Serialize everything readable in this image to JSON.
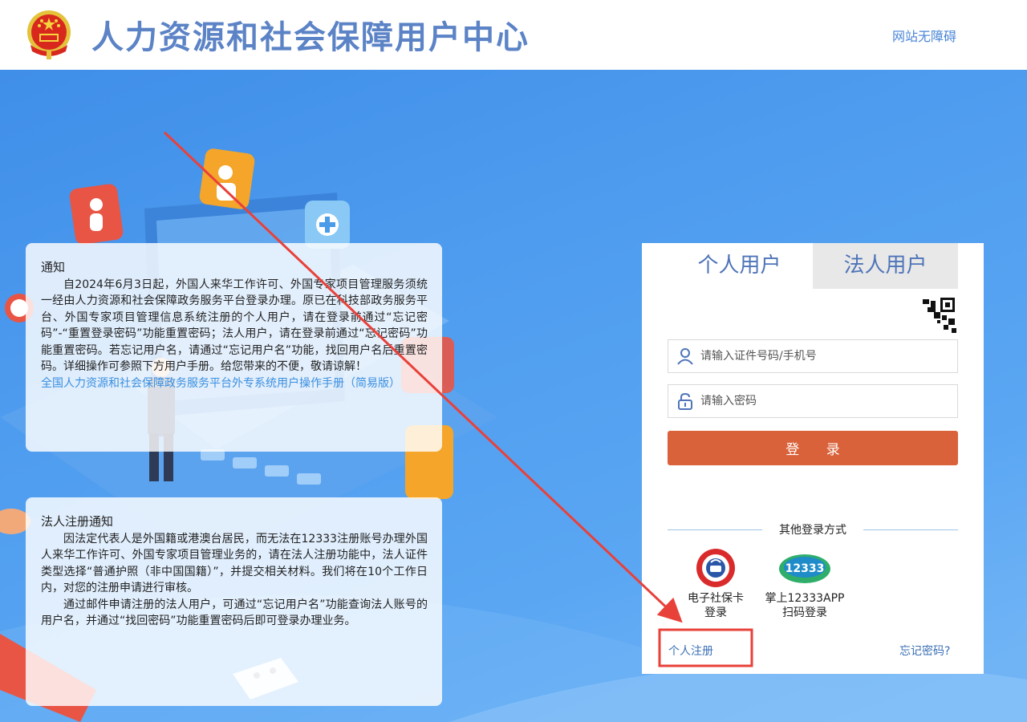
{
  "header": {
    "title": "人力资源和社会保障用户中心",
    "accessibility": "网站无障碍"
  },
  "notice_1": {
    "title": "通知",
    "body": "自2024年6月3日起，外国人来华工作许可、外国专家项目管理服务须统一经由人力资源和社会保障政务服务平台登录办理。原已在科技部政务服务平台、外国专家项目管理信息系统注册的个人用户，请在登录前通过“忘记密码”-“重置登录密码”功能重置密码；法人用户，请在登录前通过“忘记密码”功能重置密码。若忘记用户名，请通过“忘记用户名”功能，找回用户名后重置密码。详细操作可参照下方用户手册。给您带来的不便，敬请谅解！",
    "manual_link": "全国人力资源和社会保障政务服务平台外专系统用户操作手册（简易版）"
  },
  "notice_2": {
    "title": "法人注册通知",
    "para_1": "因法定代表人是外国籍或港澳台居民，而无法在12333注册账号办理外国人来华工作许可、外国专家项目管理业务的，请在法人注册功能中，法人证件类型选择“普通护照（非中国国籍）”，并提交相关材料。我们将在10个工作日内，对您的注册申请进行审核。",
    "para_2": "通过邮件申请注册的法人用户，可通过“忘记用户名”功能查询法人账号的用户名，并通过“找回密码”功能重置密码后即可登录办理业务。"
  },
  "login": {
    "tabs": [
      "个人用户",
      "法人用户"
    ],
    "active_tab": "个人用户",
    "username_placeholder": "请输入证件号码/手机号",
    "password_placeholder": "请输入密码",
    "login_button": "登 录",
    "other_methods_title": "其他登录方式",
    "alt_ssc_line1": "电子社保卡",
    "alt_ssc_line2": "登录",
    "alt_app_line1": "掌上12333APP",
    "alt_app_line2": "扫码登录",
    "register": "个人注册",
    "forgot": "忘记密码?"
  },
  "colors": {
    "title_blue": "#5b83c6",
    "login_button": "#d9623a",
    "annotation_red": "#e8413a",
    "hero_blue": "#4e9cef"
  }
}
